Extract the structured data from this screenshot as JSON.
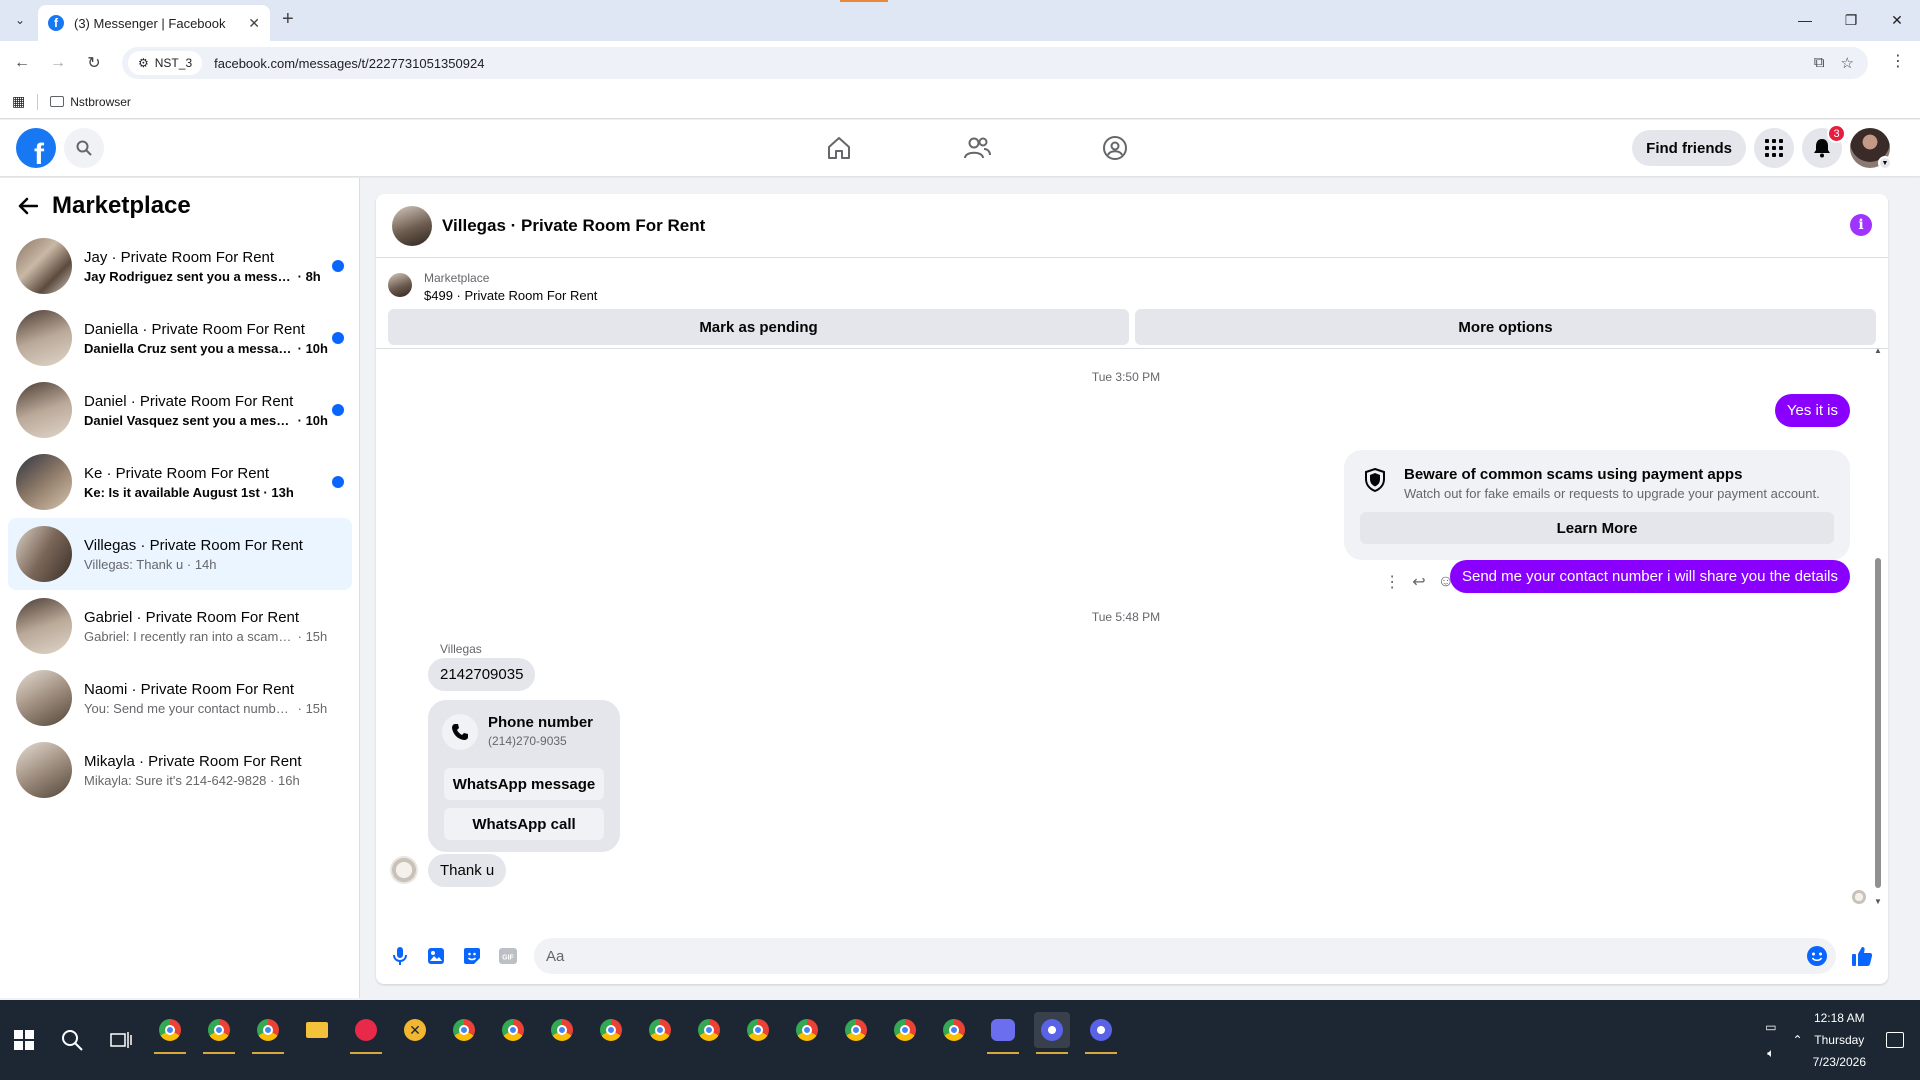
{
  "browser": {
    "tab_title": "(3) Messenger | Facebook",
    "profile_chip": "NST_3",
    "url": "facebook.com/messages/t/2227731051350924",
    "bookmark_folder": "Nstbrowser"
  },
  "fb_header": {
    "find_friends_label": "Find friends",
    "notification_count": "3"
  },
  "left_panel": {
    "title": "Marketplace",
    "conversations": [
      {
        "name": "Jay · Private Room For Rent",
        "snippet": "Jay Rodriguez sent you a messag...",
        "time": "8h",
        "unread": true
      },
      {
        "name": "Daniella · Private Room For Rent",
        "snippet": "Daniella Cruz sent you a messag...",
        "time": "10h",
        "unread": true
      },
      {
        "name": "Daniel · Private Room For Rent",
        "snippet": "Daniel Vasquez sent you a mess...",
        "time": "10h",
        "unread": true
      },
      {
        "name": "Ke · Private Room For Rent",
        "snippet": "Ke: Is it available August 1st",
        "time": "13h",
        "unread": true
      },
      {
        "name": "Villegas · Private Room For Rent",
        "snippet": "Villegas: Thank u",
        "time": "14h",
        "unread": false
      },
      {
        "name": "Gabriel · Private Room For Rent",
        "snippet": "Gabriel: I recently ran into a scamm...",
        "time": "15h",
        "unread": false
      },
      {
        "name": "Naomi · Private Room For Rent",
        "snippet": "You: Send me your contact number...",
        "time": "15h",
        "unread": false
      },
      {
        "name": "Mikayla · Private Room For Rent",
        "snippet": "Mikayla: Sure it's 214-642-9828",
        "time": "16h",
        "unread": false
      }
    ]
  },
  "chat": {
    "title": "Villegas · Private Room For Rent",
    "listing": {
      "category": "Marketplace",
      "price_title": "$499 · Private Room For Rent",
      "mark_pending_label": "Mark as pending",
      "more_options_label": "More options"
    },
    "messages": {
      "timestamp_1": "Tue 3:50 PM",
      "out_1": "Yes it is",
      "scam_title": "Beware of common scams using payment apps",
      "scam_sub": "Watch out for fake emails or requests to upgrade your payment account.",
      "learn_more_label": "Learn More",
      "out_2": "Send me your contact number i will share you the details",
      "timestamp_2": "Tue 5:48 PM",
      "sender": "Villegas",
      "in_1": "2142709035",
      "phone_title": "Phone number",
      "phone_value": "(214)270-9035",
      "wa_message_label": "WhatsApp message",
      "wa_call_label": "WhatsApp call",
      "in_2": "Thank u"
    },
    "composer_placeholder": "Aa"
  },
  "taskbar": {
    "time": "12:18 AM",
    "day": "Thursday",
    "date": "7/23/2026"
  },
  "colors": {
    "fb_blue": "#1877f2",
    "outgoing_bubble": "#8a00ff",
    "unread_dot": "#0866ff",
    "active_conv_bg": "#ebf5ff"
  }
}
